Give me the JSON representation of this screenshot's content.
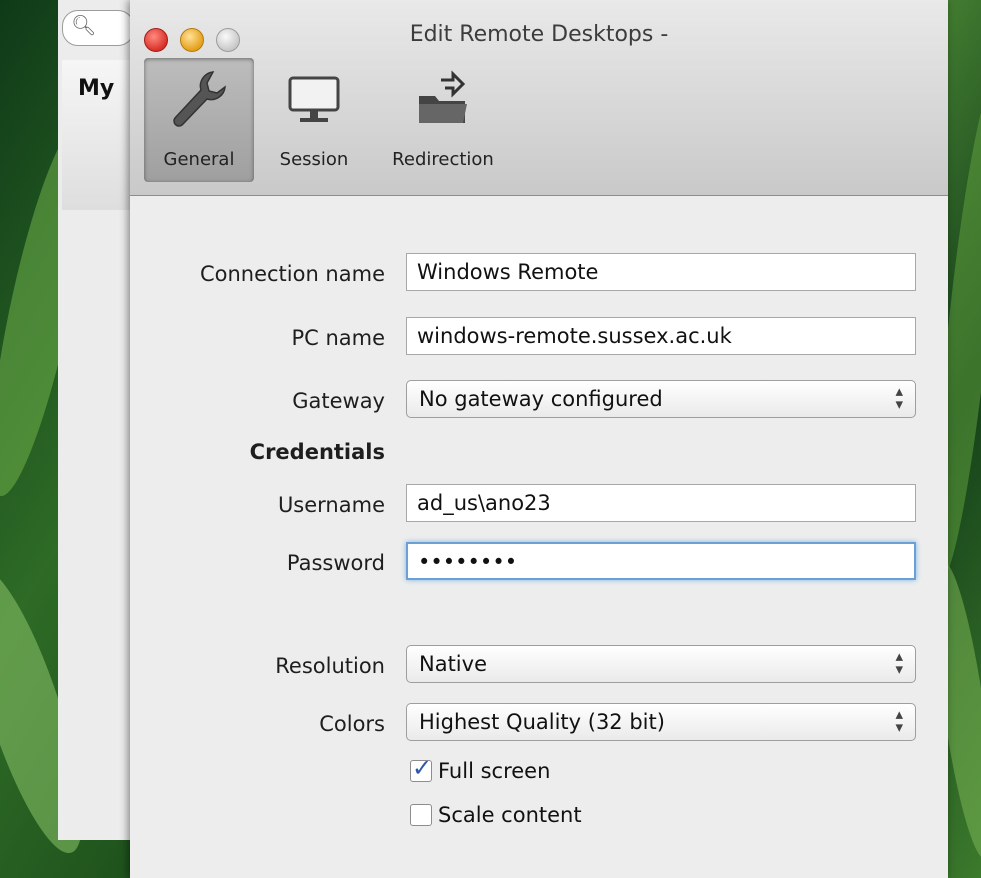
{
  "background_app": {
    "search_icon": "magnifier-icon",
    "sidebar_label": "My"
  },
  "window": {
    "title": "Edit Remote Desktops -"
  },
  "toolbar": {
    "general_label": "General",
    "session_label": "Session",
    "redirection_label": "Redirection",
    "general_icon": "wrench-icon",
    "session_icon": "monitor-icon",
    "redirection_icon": "folder-redirect-icon"
  },
  "form": {
    "connection_name": {
      "label": "Connection name",
      "value": "Windows Remote"
    },
    "pc_name": {
      "label": "PC name",
      "value": "windows-remote.sussex.ac.uk"
    },
    "gateway": {
      "label": "Gateway",
      "value": "No gateway configured"
    },
    "credentials_heading": "Credentials",
    "username": {
      "label": "Username",
      "value": "ad_us\\ano23"
    },
    "password": {
      "label": "Password",
      "value": "••••••••"
    },
    "resolution": {
      "label": "Resolution",
      "value": "Native"
    },
    "colors": {
      "label": "Colors",
      "value": "Highest Quality (32 bit)"
    },
    "full_screen": {
      "label": "Full screen",
      "checked": true
    },
    "scale_content": {
      "label": "Scale content",
      "checked": false
    }
  },
  "colors": {
    "focus_ring": "#6aa0d6",
    "close": "#d8322a",
    "minimize": "#e5a01a"
  }
}
